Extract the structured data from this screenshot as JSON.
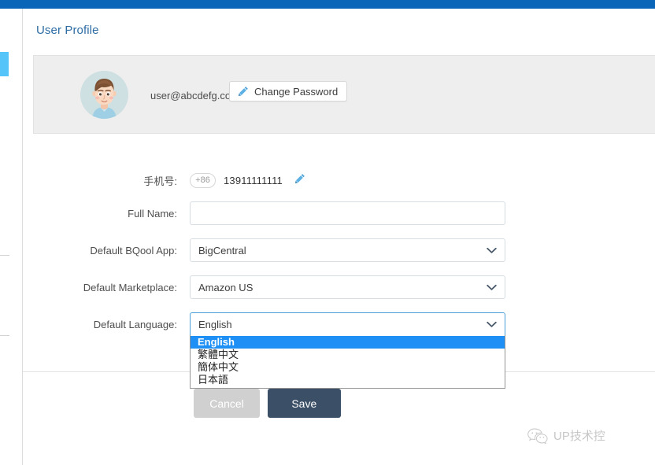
{
  "page": {
    "title": "User Profile"
  },
  "profile": {
    "email": "user@abcdefg.com",
    "change_password_label": "Change Password",
    "pencil_icon": "pencil-icon",
    "avatar_icon": "avatar"
  },
  "form": {
    "rows": [
      {
        "label": "手机号:",
        "type": "phone"
      },
      {
        "label": "Full Name:",
        "type": "text"
      },
      {
        "label": "Default BQool App:",
        "type": "select"
      },
      {
        "label": "Default Marketplace:",
        "type": "select"
      },
      {
        "label": "Default Language:",
        "type": "select"
      }
    ],
    "phone": {
      "country_code": "+86",
      "number": "13911111111",
      "edit_icon": "pencil-icon"
    },
    "full_name": {
      "value": "",
      "placeholder": ""
    },
    "default_app": {
      "value": "BigCentral"
    },
    "default_marketplace": {
      "value": "Amazon US"
    },
    "default_language": {
      "value": "English",
      "options": [
        {
          "label": "English",
          "selected": true
        },
        {
          "label": "繁體中文",
          "selected": false
        },
        {
          "label": "簡体中文",
          "selected": false
        },
        {
          "label": "日本語",
          "selected": false
        }
      ]
    }
  },
  "footer": {
    "cancel_label": "Cancel",
    "save_label": "Save"
  },
  "watermark": {
    "text": "UP技术控",
    "icon": "wechat-icon"
  },
  "colors": {
    "topbar_blue": "#0a64b7",
    "left_tab_blue": "#55c4f8",
    "title_blue": "#2e6da4",
    "panel_gray": "#eeeeee",
    "highlight_blue": "#1e90f5",
    "save_navy": "#3b4f66",
    "cancel_gray": "#d0d0d0",
    "focus_border": "#4a9fd8"
  }
}
